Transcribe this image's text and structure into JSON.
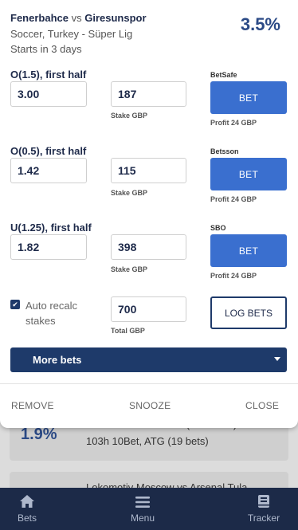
{
  "background_list": {
    "cards": [
      {
        "pct": "1.9%",
        "match": "Airdrie vs Kilmarnock (Reserves)",
        "meta": "103h 10Bet, ATG (19 bets)"
      },
      {
        "match": "Lokomotiv Moscow vs Arsenal Tula"
      }
    ]
  },
  "event": {
    "home": "Fenerbahce",
    "vs": "vs",
    "away": "Giresunspor",
    "league": "Soccer, Turkey - Süper Lig",
    "starts": "Starts in 3 days",
    "profit_pct": "3.5%"
  },
  "bets": [
    {
      "market": "O(1.5), first half",
      "odds": "3.00",
      "stake": "187",
      "stake_label": "Stake GBP",
      "bookmaker": "BetSafe",
      "bet_label": "BET",
      "profit": "Profit 24 GBP"
    },
    {
      "market": "O(0.5), first half",
      "odds": "1.42",
      "stake": "115",
      "stake_label": "Stake GBP",
      "bookmaker": "Betsson",
      "bet_label": "BET",
      "profit": "Profit 24 GBP"
    },
    {
      "market": "U(1.25), first half",
      "odds": "1.82",
      "stake": "398",
      "stake_label": "Stake GBP",
      "bookmaker": "SBO",
      "bet_label": "BET",
      "profit": "Profit 24 GBP"
    }
  ],
  "auto_recalc": {
    "label": "Auto recalc stakes",
    "checked": true,
    "check_glyph": "✔"
  },
  "total": {
    "value": "700",
    "label": "Total GBP"
  },
  "log_bets_label": "LOG BETS",
  "more_bets_label": "More bets",
  "footer": {
    "remove": "REMOVE",
    "snooze": "SNOOZE",
    "close": "CLOSE"
  },
  "nav": {
    "items": [
      {
        "label": "Bets",
        "icon": "home-icon"
      },
      {
        "label": "Menu",
        "icon": "hamburger-icon"
      },
      {
        "label": "Tracker",
        "icon": "book-icon"
      }
    ]
  },
  "colors": {
    "accent": "#3a6fcf",
    "navy": "#1e3a6a",
    "nav_bg": "#1c2a48",
    "percent": "#2b4a86"
  }
}
